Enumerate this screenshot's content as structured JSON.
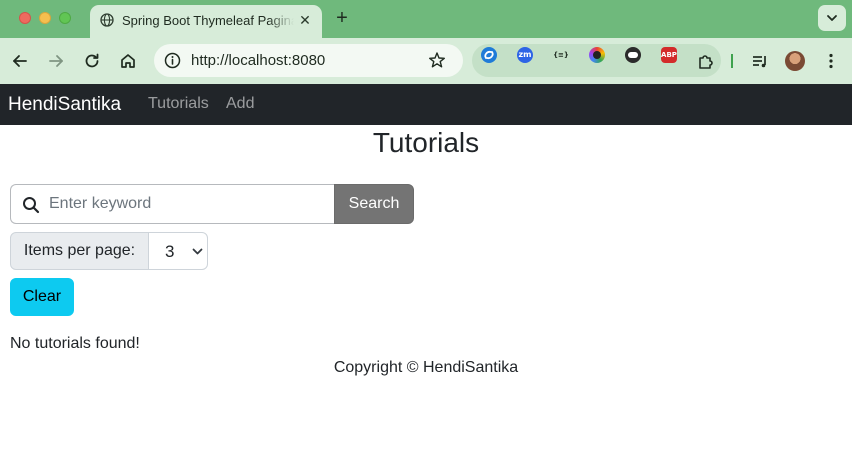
{
  "browser": {
    "tab": {
      "title": "Spring Boot Thymeleaf Pagination"
    },
    "omnibox": {
      "url": "http://localhost:8080"
    },
    "extensions": [
      {
        "name": "smartsync-icon",
        "color": "#1f7bd8",
        "label": ""
      },
      {
        "name": "zoom-icon",
        "color": "#2d64e6",
        "label": "zm"
      },
      {
        "name": "json-formatter-icon",
        "color": "#c4e0c7",
        "label": "{≡}"
      },
      {
        "name": "color-picker-icon",
        "color": "#333333",
        "label": ""
      },
      {
        "name": "bot-icon",
        "color": "#2b2b2b",
        "label": ""
      },
      {
        "name": "adblock-plus-icon",
        "color": "#d32b2b",
        "label": "ABP"
      }
    ]
  },
  "navbar": {
    "brand": "HendiSantika",
    "links": [
      "Tutorials",
      "Add"
    ]
  },
  "main": {
    "title": "Tutorials",
    "search": {
      "placeholder": "Enter keyword",
      "value": "",
      "button": "Search"
    },
    "page_size": {
      "label": "Items per page:",
      "selected": "3"
    },
    "clear_button": "Clear",
    "empty_message": "No tutorials found!"
  },
  "footer": {
    "text": "Copyright © HendiSantika"
  }
}
